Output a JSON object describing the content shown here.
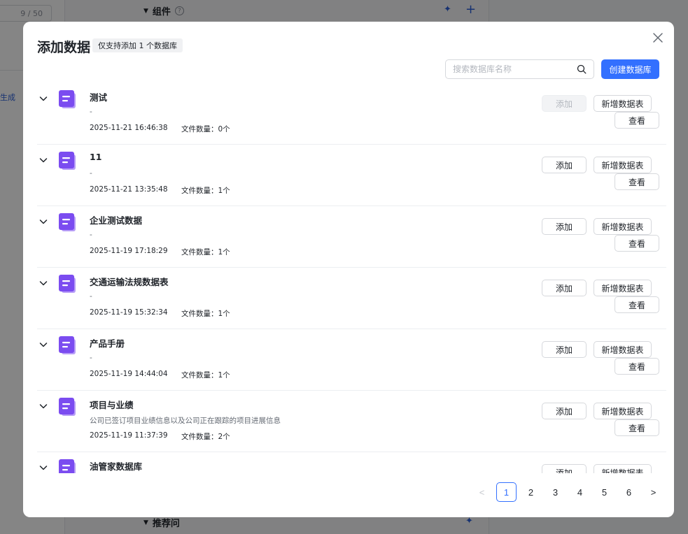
{
  "background": {
    "counter": "9 / 50",
    "left_link": "生成",
    "section_components": "组件",
    "section_suggest": "推荐问"
  },
  "modal": {
    "title": "添加数据",
    "tag": "仅支持添加 1 个数据库",
    "search_placeholder": "搜索数据库名称",
    "create_label": "创建数据库"
  },
  "rows": [
    {
      "name": "测试",
      "desc": "-",
      "date": "2025-11-21 16:46:38",
      "files": "文件数量：0个",
      "add": "添加",
      "add_disabled": true,
      "new_table": "新增数据表",
      "view": "查看"
    },
    {
      "name": "11",
      "desc": "-",
      "date": "2025-11-21 13:35:48",
      "files": "文件数量：1个",
      "add": "添加",
      "add_disabled": false,
      "new_table": "新增数据表",
      "view": "查看"
    },
    {
      "name": "企业测试数据",
      "desc": "-",
      "date": "2025-11-19 17:18:29",
      "files": "文件数量：1个",
      "add": "添加",
      "add_disabled": false,
      "new_table": "新增数据表",
      "view": "查看"
    },
    {
      "name": "交通运输法规数据表",
      "desc": "-",
      "date": "2025-11-19 15:32:34",
      "files": "文件数量：1个",
      "add": "添加",
      "add_disabled": false,
      "new_table": "新增数据表",
      "view": "查看"
    },
    {
      "name": "产品手册",
      "desc": "-",
      "date": "2025-11-19 14:44:04",
      "files": "文件数量：1个",
      "add": "添加",
      "add_disabled": false,
      "new_table": "新增数据表",
      "view": "查看"
    },
    {
      "name": "项目与业绩",
      "desc": "公司已签订项目业绩信息以及公司正在跟踪的项目进展信息",
      "date": "2025-11-19 11:37:39",
      "files": "文件数量：2个",
      "add": "添加",
      "add_disabled": false,
      "new_table": "新增数据表",
      "view": "查看"
    },
    {
      "name": "油管家数据库",
      "desc": "",
      "date": "",
      "files": "",
      "add": "添加",
      "add_disabled": false,
      "new_table": "新增数据表",
      "view": ""
    }
  ],
  "pagination": {
    "prev": "<",
    "next": ">",
    "pages": [
      "1",
      "2",
      "3",
      "4",
      "5",
      "6"
    ],
    "current": "1"
  },
  "colors": {
    "accent": "#3370ff",
    "db_icon": "#7b4cf0"
  }
}
